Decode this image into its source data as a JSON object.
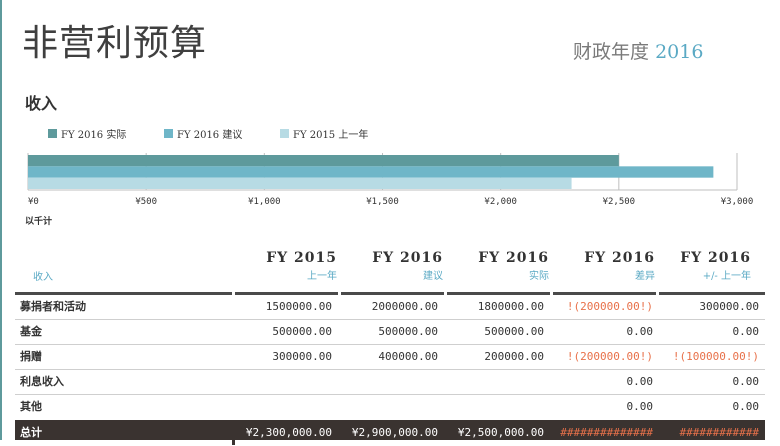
{
  "title": "非营利预算",
  "fiscal_year": {
    "label": "财政年度",
    "year": "2016"
  },
  "section": "收入",
  "unit_label": "以千计",
  "colors": {
    "actual_2016": "#5e9a9c",
    "proposed_2016": "#6fb6c8",
    "prior_2015": "#b7dbe4",
    "accent": "#5aa9c4",
    "negative": "#e8714a"
  },
  "chart_data": {
    "type": "bar",
    "orientation": "horizontal",
    "xlim": [
      0,
      3000
    ],
    "xticks": [
      "¥0",
      "¥500",
      "¥1,000",
      "¥1,500",
      "¥2,000",
      "¥2,500",
      "¥3,000"
    ],
    "series": [
      {
        "name": "FY 2016 实际",
        "values": [
          2500
        ]
      },
      {
        "name": "FY 2016 建议",
        "values": [
          2900
        ]
      },
      {
        "name": "FY 2015 上一年",
        "values": [
          2300
        ]
      }
    ]
  },
  "table": {
    "row_header": "收入",
    "columns": [
      {
        "h1": "FY 2015",
        "h2": "上一年"
      },
      {
        "h1": "FY 2016",
        "h2": "建议"
      },
      {
        "h1": "FY 2016",
        "h2": "实际"
      },
      {
        "h1": "FY 2016",
        "h2": "差异"
      },
      {
        "h1": "FY 2016",
        "h2": "+/- 上一年"
      }
    ],
    "rows": [
      {
        "label": "募捐者和活动",
        "cells": [
          "1500000.00",
          "2000000.00",
          "1800000.00",
          "!(200000.00!)",
          "300000.00"
        ]
      },
      {
        "label": "基金",
        "cells": [
          "500000.00",
          "500000.00",
          "500000.00",
          "0.00",
          "0.00"
        ]
      },
      {
        "label": "捐赠",
        "cells": [
          "300000.00",
          "400000.00",
          "200000.00",
          "!(200000.00!)",
          "!(100000.00!)"
        ]
      },
      {
        "label": "利息收入",
        "cells": [
          "",
          "",
          "",
          "0.00",
          "0.00"
        ]
      },
      {
        "label": "其他",
        "cells": [
          "",
          "",
          "",
          "0.00",
          "0.00"
        ]
      }
    ],
    "total": {
      "label": "总计",
      "cells": [
        "¥2,300,000.00",
        "¥2,900,000.00",
        "¥2,500,000.00",
        "##############",
        "############"
      ]
    }
  }
}
